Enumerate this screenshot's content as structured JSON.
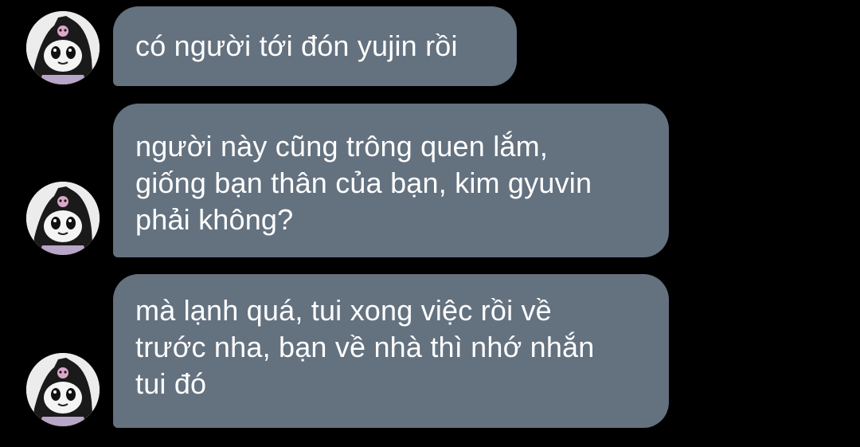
{
  "chat": {
    "messages": [
      {
        "lines": [
          "có người tới đón yujin rồi"
        ]
      },
      {
        "lines": [
          "người này cũng trông quen lắm,",
          "giống bạn thân của bạn, kim gyuvin",
          "phải không?"
        ]
      },
      {
        "lines": [
          "mà lạnh quá, tui xong việc rồi về",
          "trước nha, bạn về nhà thì nhớ nhắn",
          "tui đó"
        ]
      }
    ],
    "avatar_icon": "kuromi-avatar-icon",
    "colors": {
      "background": "#000000",
      "bubble": "#64717f",
      "text": "#ffffff"
    }
  }
}
